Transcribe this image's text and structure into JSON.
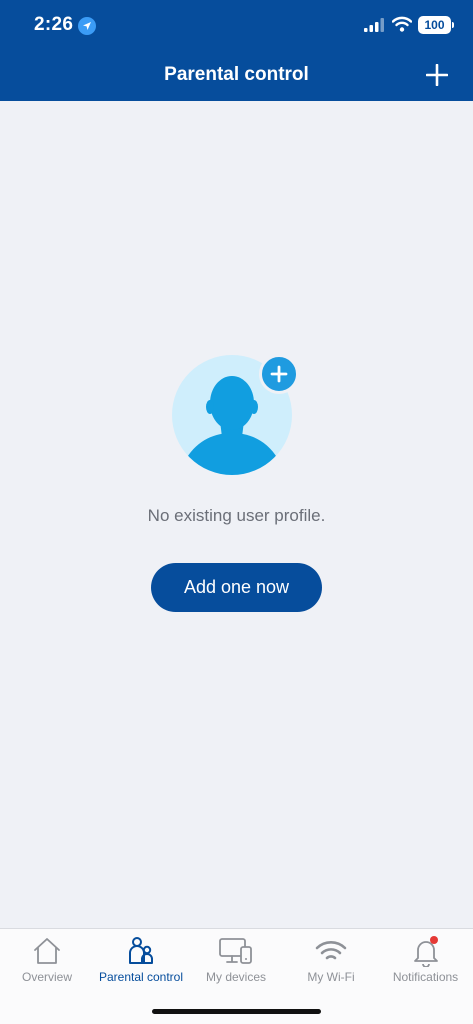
{
  "status_bar": {
    "time": "2:26",
    "battery": "100"
  },
  "header": {
    "title": "Parental control"
  },
  "empty_state": {
    "message": "No existing user profile.",
    "button_label": "Add one now"
  },
  "tabs": [
    {
      "label": "Overview",
      "icon": "home-icon"
    },
    {
      "label": "Parental control",
      "icon": "family-icon",
      "active": true
    },
    {
      "label": "My devices",
      "icon": "devices-icon"
    },
    {
      "label": "My Wi-Fi",
      "icon": "wifi-icon"
    },
    {
      "label": "Notifications",
      "icon": "bell-icon",
      "badge": true
    }
  ],
  "colors": {
    "primary": "#064d9c",
    "accent": "#1f9be0",
    "avatar_bg": "#cfeefc",
    "background": "#eff1f6",
    "badge": "#e53935"
  }
}
